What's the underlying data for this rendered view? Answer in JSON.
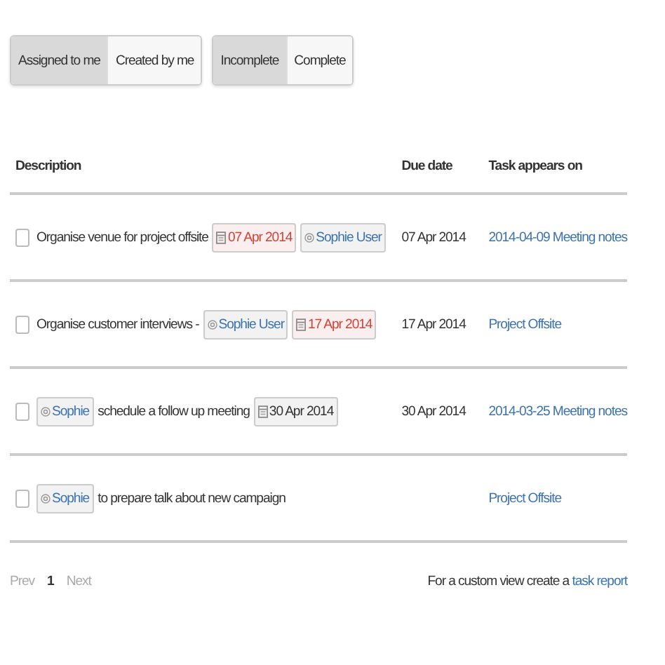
{
  "filters": [
    {
      "buttons": [
        {
          "label": "Assigned to me",
          "selected": true
        },
        {
          "label": "Created by me",
          "selected": false
        }
      ]
    },
    {
      "buttons": [
        {
          "label": "Incomplete",
          "selected": true
        },
        {
          "label": "Complete",
          "selected": false
        }
      ]
    }
  ],
  "table": {
    "columns": [
      "Description",
      "Due date",
      "Task appears on"
    ],
    "rows": [
      {
        "checked": false,
        "description": [
          {
            "kind": "text",
            "text": "Organise venue for project offsite"
          },
          {
            "kind": "date",
            "text": "07 Apr 2014",
            "overdue": true
          },
          {
            "kind": "mention",
            "text": "Sophie User"
          }
        ],
        "due_date": "07 Apr 2014",
        "page": "2014-04-09 Meeting notes"
      },
      {
        "checked": false,
        "description": [
          {
            "kind": "text",
            "text": "Organise customer interviews -"
          },
          {
            "kind": "mention",
            "text": "Sophie User"
          },
          {
            "kind": "date",
            "text": "17 Apr 2014",
            "overdue": true
          }
        ],
        "due_date": "17 Apr 2014",
        "page": "Project Offsite"
      },
      {
        "checked": false,
        "description": [
          {
            "kind": "mention",
            "text": "Sophie"
          },
          {
            "kind": "text",
            "text": "schedule a follow up meeting"
          },
          {
            "kind": "date",
            "text": "30 Apr 2014",
            "overdue": false
          }
        ],
        "due_date": "30 Apr 2014",
        "page": "2014-03-25 Meeting notes"
      },
      {
        "checked": false,
        "description": [
          {
            "kind": "mention",
            "text": "Sophie"
          },
          {
            "kind": "text",
            "text": "to prepare talk about new campaign"
          }
        ],
        "page": "Project Offsite"
      }
    ]
  },
  "pagination": [
    {
      "label": "Prev",
      "kind": "prev",
      "disabled": true
    },
    {
      "label": "1",
      "kind": "page",
      "selected": true
    },
    {
      "label": "Next",
      "kind": "next",
      "disabled": true
    }
  ],
  "footer": {
    "text": "For a custom view create a",
    "link": "task report"
  }
}
